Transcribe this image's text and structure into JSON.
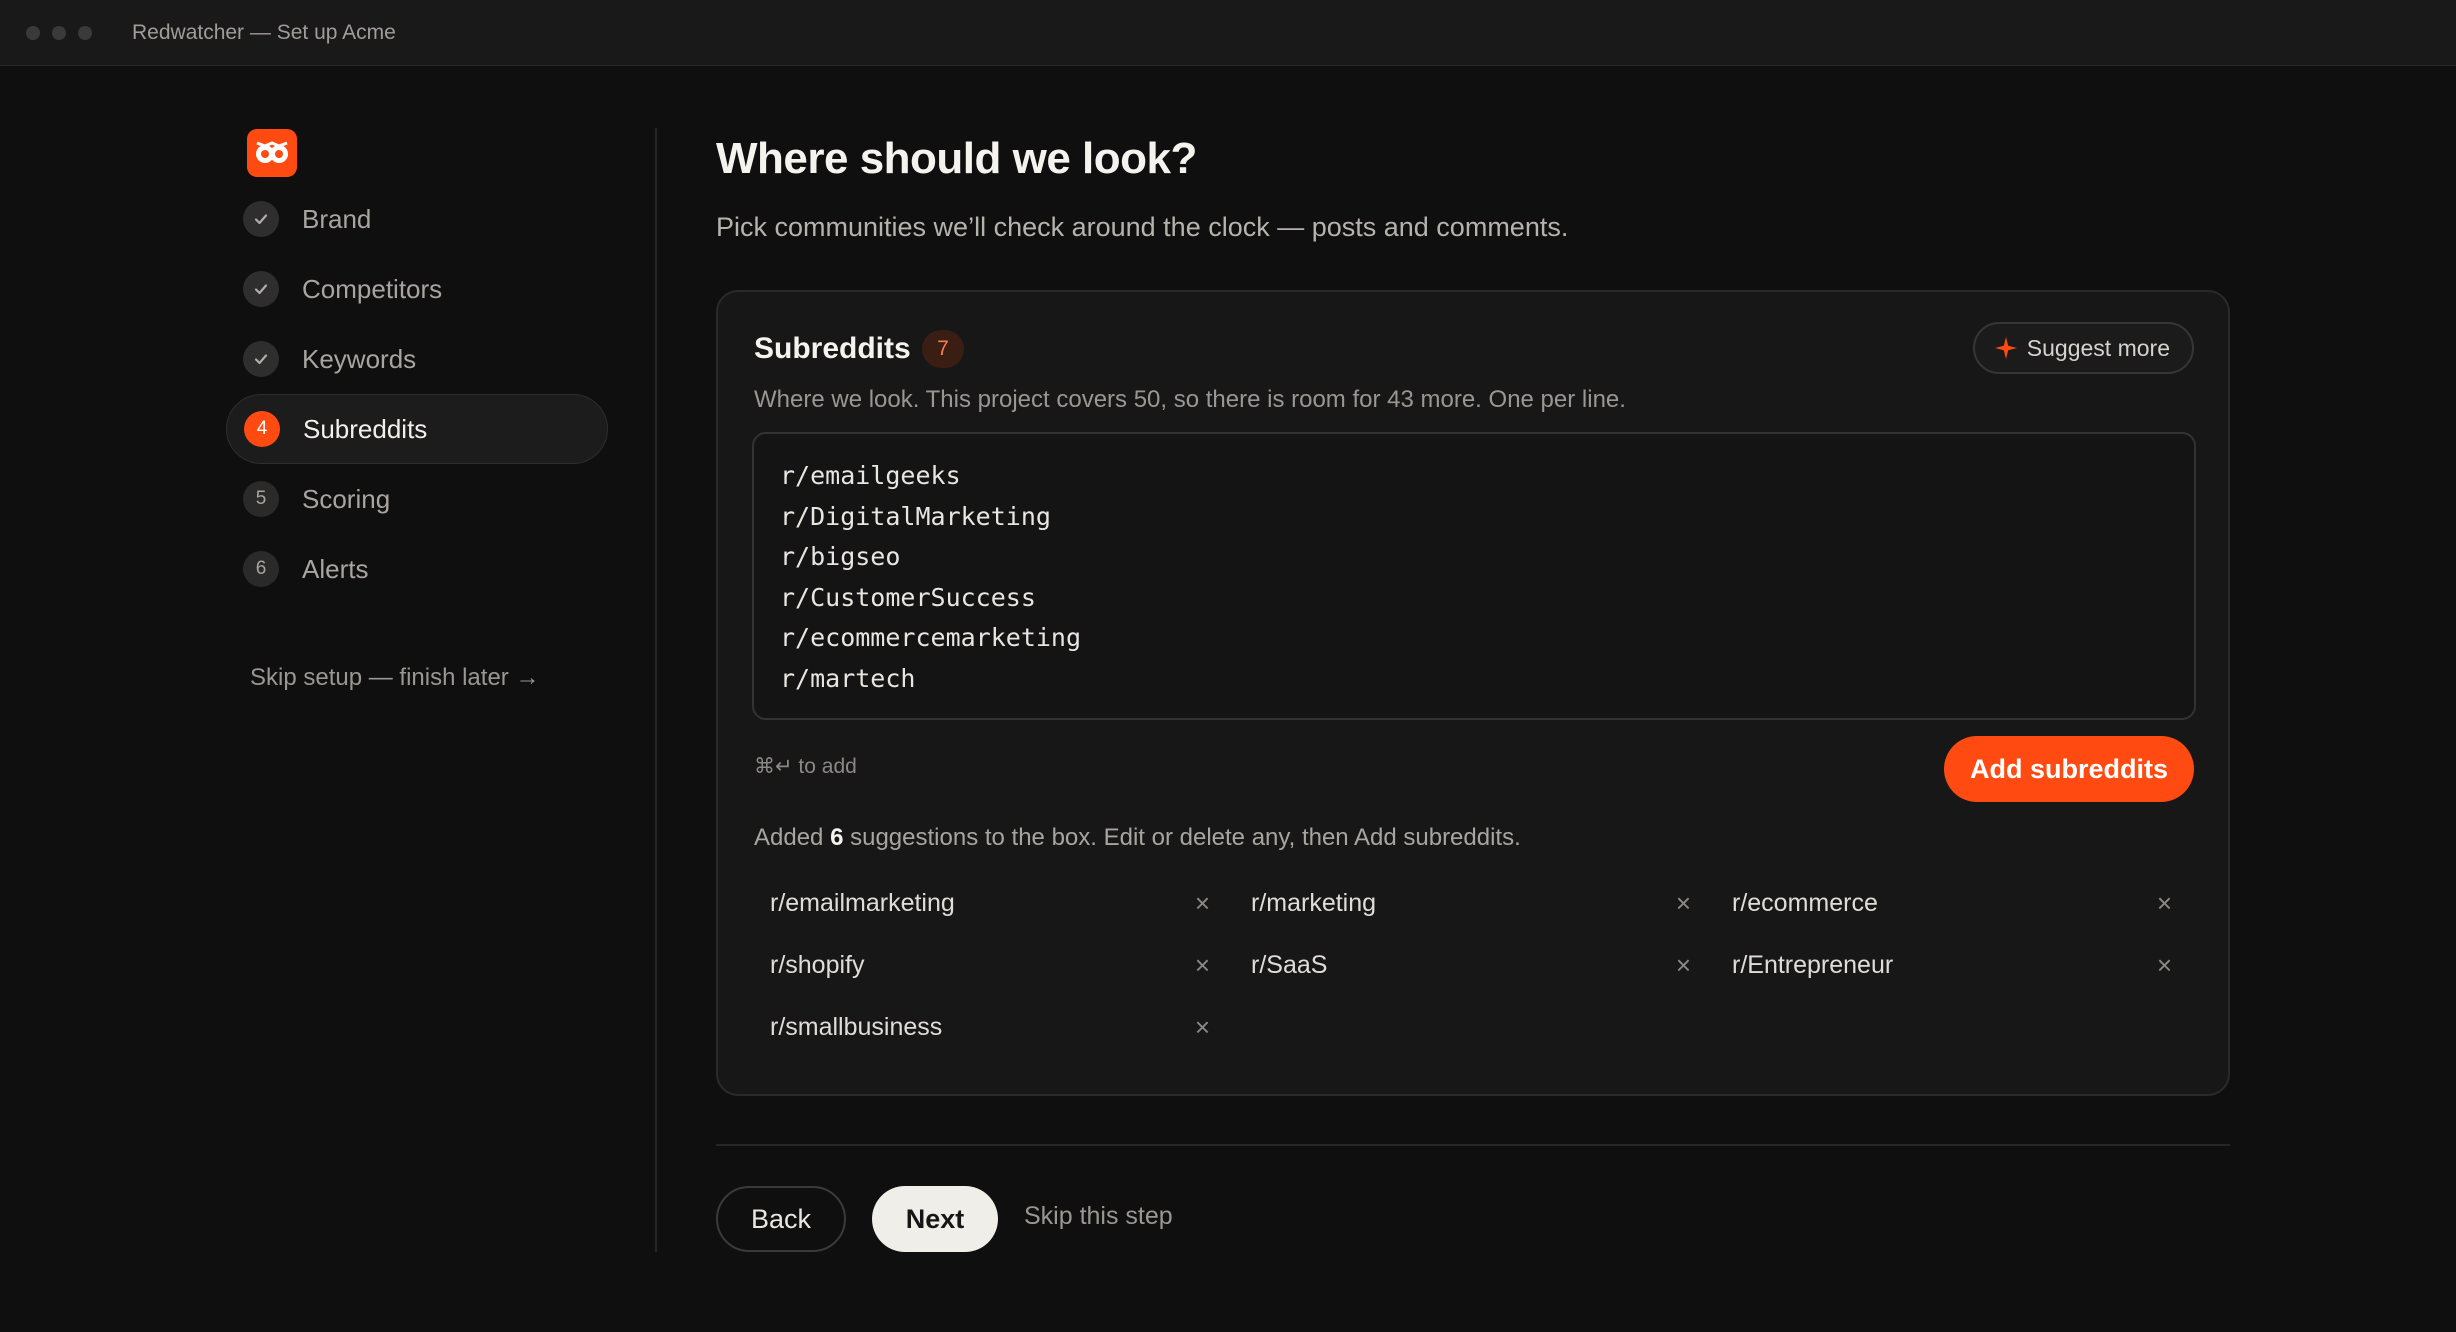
{
  "window": {
    "title": "Redwatcher — Set up Acme"
  },
  "colors": {
    "accent": "#ff4b12",
    "background": "#0f0f0f",
    "card": "#171717"
  },
  "sidebar": {
    "logo": "owl-logo-icon",
    "items": [
      {
        "badge": "",
        "label": "Brand",
        "state": "done"
      },
      {
        "badge": "",
        "label": "Competitors",
        "state": "done"
      },
      {
        "badge": "",
        "label": "Keywords",
        "state": "done"
      },
      {
        "badge": "4",
        "label": "Subreddits",
        "state": "current"
      },
      {
        "badge": "5",
        "label": "Scoring",
        "state": "pending"
      },
      {
        "badge": "6",
        "label": "Alerts",
        "state": "pending"
      }
    ],
    "skip_setup": "Skip setup — finish later →"
  },
  "main": {
    "title": "Where should we look?",
    "subtitle": "Pick communities we’ll check around the clock — posts and comments."
  },
  "card": {
    "title": "Subreddits",
    "count": "7",
    "suggest_label": "Suggest more",
    "description": "Where we look. This project covers 50, so there is room for 43 more. One per line.",
    "textarea_lines": [
      "r/emailgeeks",
      "r/DigitalMarketing",
      "r/bigseo",
      "r/CustomerSuccess",
      "r/ecommercemarketing",
      "r/martech"
    ],
    "shortcut_hint": "⌘↵ to add",
    "add_label": "Add subreddits",
    "added_msg_prefix": "Added ",
    "added_msg_count": "6",
    "added_msg_suffix": " suggestions to the box. Edit or delete any, then Add subreddits.",
    "chips": [
      "r/emailmarketing",
      "r/marketing",
      "r/ecommerce",
      "r/shopify",
      "r/SaaS",
      "r/Entrepreneur",
      "r/smallbusiness"
    ]
  },
  "footer": {
    "back_label": "Back",
    "next_label": "Next",
    "skip_step_label": "Skip this step"
  }
}
